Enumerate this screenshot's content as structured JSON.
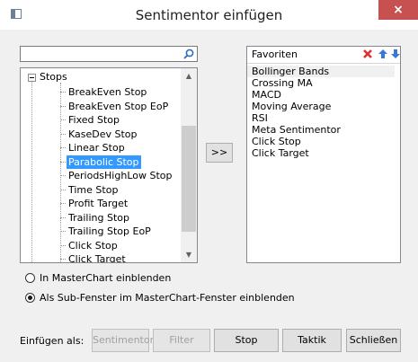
{
  "window": {
    "title": "Sentimentor einfügen",
    "close_label": "×"
  },
  "search": {
    "value": "",
    "icon": "search-icon"
  },
  "tree": {
    "root_label": "Stops",
    "items": [
      {
        "label": "BreakEven Stop"
      },
      {
        "label": "BreakEven Stop EoP"
      },
      {
        "label": "Fixed Stop"
      },
      {
        "label": "KaseDev Stop"
      },
      {
        "label": "Linear Stop"
      },
      {
        "label": "Parabolic Stop",
        "selected": true
      },
      {
        "label": "PeriodsHighLow Stop"
      },
      {
        "label": "Time Stop"
      },
      {
        "label": "Profit Target"
      },
      {
        "label": "Trailing Stop"
      },
      {
        "label": "Trailing Stop EoP"
      },
      {
        "label": "Click Stop"
      },
      {
        "label": "Click Target"
      }
    ],
    "scroll_up": "▲",
    "scroll_down": "▼"
  },
  "move_button_label": ">>",
  "favorites": {
    "header": "Favoriten",
    "items": [
      "Bollinger Bands",
      "Crossing MA",
      "MACD",
      "Moving Average",
      "RSI",
      "Meta Sentimentor",
      "Click Stop",
      "Click Target"
    ],
    "colors": {
      "delete": "#e03030",
      "arrows": "#3a78d8"
    }
  },
  "options": {
    "masterchart_label": "In MasterChart einblenden",
    "subwindow_label": "Als Sub-Fenster im MasterChart-Fenster einblenden",
    "selected": "subwindow"
  },
  "footer": {
    "insert_label": "Einfügen als:",
    "buttons": {
      "sentimentor": "Sentimentor",
      "filter": "Filter",
      "stop": "Stop",
      "taktik": "Taktik",
      "close": "Schließen"
    }
  }
}
